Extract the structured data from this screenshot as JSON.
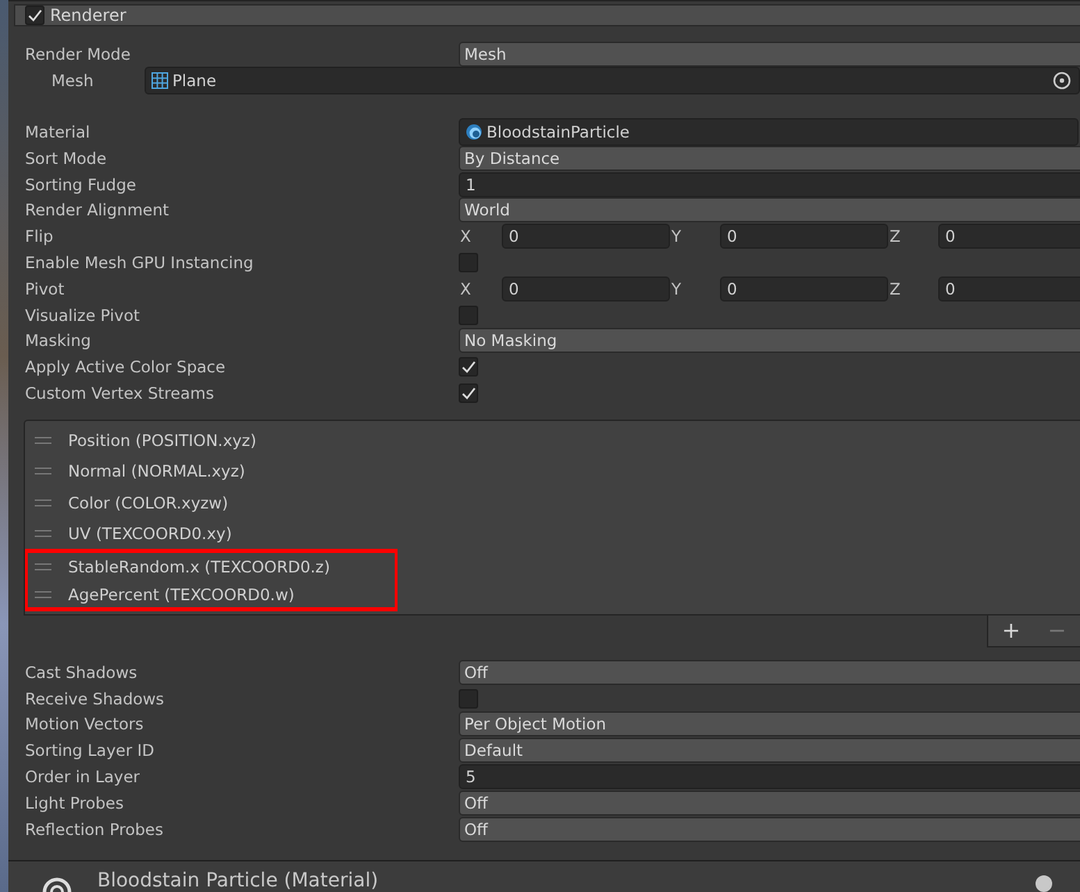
{
  "module": {
    "title": "Renderer",
    "enabled": true
  },
  "block_1": [
    {
      "kind": "dropdown",
      "label": "Render Mode",
      "value": "Mesh"
    },
    {
      "kind": "mesh",
      "label": "Mesh",
      "value": "Plane",
      "indented": true
    }
  ],
  "block_2": [
    {
      "kind": "material",
      "label": "Material",
      "value": "BloodstainParticle"
    },
    {
      "kind": "dropdown",
      "label": "Sort Mode",
      "value": "By Distance"
    },
    {
      "kind": "number",
      "label": "Sorting Fudge",
      "value": "1"
    },
    {
      "kind": "dropdown",
      "label": "Render Alignment",
      "value": "World"
    },
    {
      "kind": "vector",
      "label": "Flip",
      "axes": [
        {
          "axis": "X",
          "value": "0"
        },
        {
          "axis": "Y",
          "value": "0"
        },
        {
          "axis": "Z",
          "value": "0"
        }
      ]
    },
    {
      "kind": "checkbox",
      "label": "Enable Mesh GPU Instancing",
      "checked": false
    },
    {
      "kind": "vector",
      "label": "Pivot",
      "axes": [
        {
          "axis": "X",
          "value": "0"
        },
        {
          "axis": "Y",
          "value": "0"
        },
        {
          "axis": "Z",
          "value": "0"
        }
      ]
    },
    {
      "kind": "checkbox",
      "label": "Visualize Pivot",
      "checked": false
    },
    {
      "kind": "dropdown",
      "label": "Masking",
      "value": "No Masking"
    },
    {
      "kind": "checkbox",
      "label": "Apply Active Color Space",
      "checked": true
    },
    {
      "kind": "checkbox",
      "label": "Custom Vertex Streams",
      "checked": true
    }
  ],
  "vertex_streams": {
    "items": [
      {
        "label": "Position (POSITION.xyz)",
        "highlighted": false
      },
      {
        "label": "Normal (NORMAL.xyz)",
        "highlighted": false
      },
      {
        "label": "Color (COLOR.xyzw)",
        "highlighted": false
      },
      {
        "label": "UV (TEXCOORD0.xy)",
        "highlighted": false
      },
      {
        "label": "StableRandom.x (TEXCOORD0.z)",
        "highlighted": true
      },
      {
        "label": "AgePercent (TEXCOORD0.w)",
        "highlighted": true
      }
    ],
    "add_button": "+",
    "remove_button": "−"
  },
  "block_3": [
    {
      "kind": "dropdown",
      "label": "Cast Shadows",
      "value": "Off"
    },
    {
      "kind": "checkbox",
      "label": "Receive Shadows",
      "checked": false
    },
    {
      "kind": "dropdown",
      "label": "Motion Vectors",
      "value": "Per Object Motion"
    },
    {
      "kind": "dropdown",
      "label": "Sorting Layer ID",
      "value": "Default"
    },
    {
      "kind": "number",
      "label": "Order in Layer",
      "value": "5"
    },
    {
      "kind": "dropdown",
      "label": "Light Probes",
      "value": "Off"
    },
    {
      "kind": "dropdown",
      "label": "Reflection Probes",
      "value": "Off"
    }
  ],
  "material_header": {
    "title": "Bloodstain Particle (Material)"
  }
}
